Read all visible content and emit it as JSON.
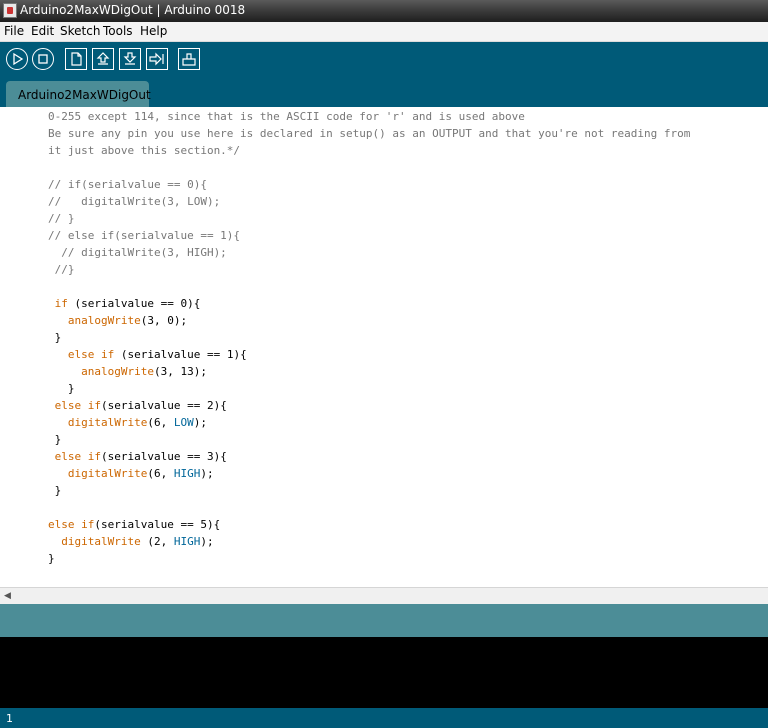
{
  "window": {
    "title": "Arduino2MaxWDigOut | Arduino 0018"
  },
  "menu": [
    "File",
    "Edit",
    "Sketch",
    "Tools",
    "Help"
  ],
  "toolbar": {
    "buttons": [
      "verify-icon",
      "stop-icon",
      "new-icon",
      "open-icon",
      "save-icon",
      "upload-icon",
      "serial-monitor-icon"
    ]
  },
  "tabs": [
    {
      "label": "Arduino2MaxWDigOut"
    }
  ],
  "code_lines": [
    {
      "text": "0-255 except 114, since that is the ASCII code for 'r' and is used above",
      "type": "comment"
    },
    {
      "text": "Be sure any pin you use here is declared in setup() as an OUTPUT and that you're not reading from",
      "type": "comment"
    },
    {
      "text": "it just above this section.*/",
      "type": "comment"
    },
    {
      "text": "",
      "type": "blank"
    },
    {
      "text": "// if(serialvalue == 0){",
      "type": "comment"
    },
    {
      "text": "//   digitalWrite(3, LOW);",
      "type": "comment"
    },
    {
      "text": "// }",
      "type": "comment"
    },
    {
      "text": "// else if(serialvalue == 1){",
      "type": "comment"
    },
    {
      "text": "  // digitalWrite(3, HIGH);",
      "type": "comment"
    },
    {
      "text": " //}",
      "type": "comment"
    },
    {
      "text": "",
      "type": "blank"
    },
    {
      "segments": [
        {
          "t": " ",
          "c": ""
        },
        {
          "t": "if",
          "c": "kw"
        },
        {
          "t": " (serialvalue == 0){",
          "c": ""
        }
      ]
    },
    {
      "segments": [
        {
          "t": "   ",
          "c": ""
        },
        {
          "t": "analogWrite",
          "c": "kw"
        },
        {
          "t": "(3, 0);",
          "c": ""
        }
      ]
    },
    {
      "segments": [
        {
          "t": " }",
          "c": ""
        }
      ]
    },
    {
      "segments": [
        {
          "t": "   ",
          "c": ""
        },
        {
          "t": "else if",
          "c": "kw"
        },
        {
          "t": " (serialvalue == 1){",
          "c": ""
        }
      ]
    },
    {
      "segments": [
        {
          "t": "     ",
          "c": ""
        },
        {
          "t": "analogWrite",
          "c": "kw"
        },
        {
          "t": "(3, 13);",
          "c": ""
        }
      ]
    },
    {
      "segments": [
        {
          "t": "   }",
          "c": ""
        }
      ]
    },
    {
      "segments": [
        {
          "t": " ",
          "c": ""
        },
        {
          "t": "else if",
          "c": "kw"
        },
        {
          "t": "(serialvalue == 2){",
          "c": ""
        }
      ]
    },
    {
      "segments": [
        {
          "t": "   ",
          "c": ""
        },
        {
          "t": "digitalWrite",
          "c": "kw"
        },
        {
          "t": "(6, ",
          "c": ""
        },
        {
          "t": "LOW",
          "c": "cst"
        },
        {
          "t": ");",
          "c": ""
        }
      ]
    },
    {
      "segments": [
        {
          "t": " }",
          "c": ""
        }
      ]
    },
    {
      "segments": [
        {
          "t": " ",
          "c": ""
        },
        {
          "t": "else if",
          "c": "kw"
        },
        {
          "t": "(serialvalue == 3){",
          "c": ""
        }
      ]
    },
    {
      "segments": [
        {
          "t": "   ",
          "c": ""
        },
        {
          "t": "digitalWrite",
          "c": "kw"
        },
        {
          "t": "(6, ",
          "c": ""
        },
        {
          "t": "HIGH",
          "c": "cst"
        },
        {
          "t": ");",
          "c": ""
        }
      ]
    },
    {
      "segments": [
        {
          "t": " }",
          "c": ""
        }
      ]
    },
    {
      "text": "",
      "type": "blank"
    },
    {
      "segments": [
        {
          "t": "else if",
          "c": "kw"
        },
        {
          "t": "(serialvalue == 5){",
          "c": ""
        }
      ]
    },
    {
      "segments": [
        {
          "t": "  ",
          "c": ""
        },
        {
          "t": "digitalWrite",
          "c": "kw"
        },
        {
          "t": " (2, ",
          "c": ""
        },
        {
          "t": "HIGH",
          "c": "cst"
        },
        {
          "t": ");",
          "c": ""
        }
      ]
    },
    {
      "segments": [
        {
          "t": "}",
          "c": ""
        }
      ]
    }
  ],
  "status": {
    "line_number": "1"
  },
  "colors": {
    "toolbar": "#005a78",
    "tab": "#4c8d97",
    "keyword": "#cc6600",
    "constant": "#006699",
    "comment": "#777777"
  }
}
